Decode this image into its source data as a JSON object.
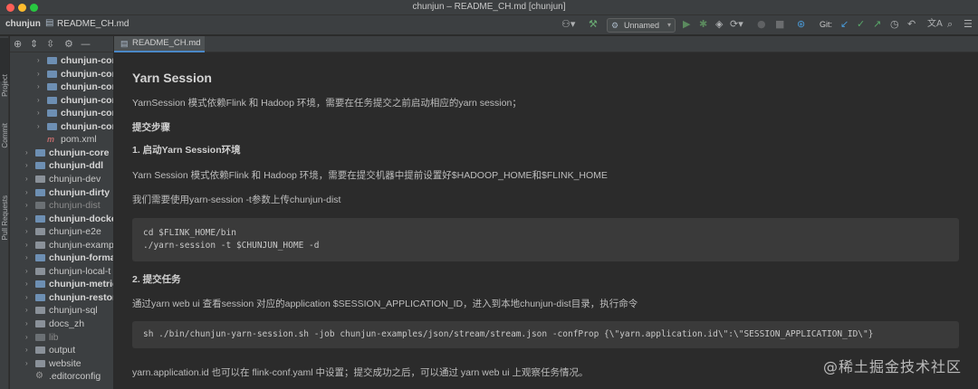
{
  "window": {
    "title": "chunjun – README_CH.md [chunjun]",
    "traffic_colors": [
      "#ff5f57",
      "#febc2e",
      "#28c840"
    ]
  },
  "navbar": {
    "project": "chunjun",
    "file": "README_CH.md",
    "run_config": "Unnamed",
    "git_label": "Git:"
  },
  "stripe": {
    "project": "Project",
    "commit": "Commit",
    "pull_requests": "Pull Requests"
  },
  "tree": [
    {
      "label": "chunjun-con",
      "kind": "module",
      "bold": true,
      "indent": 1
    },
    {
      "label": "chunjun-con",
      "kind": "module",
      "bold": true,
      "indent": 1
    },
    {
      "label": "chunjun-con",
      "kind": "module",
      "bold": true,
      "indent": 1
    },
    {
      "label": "chunjun-con",
      "kind": "module",
      "bold": true,
      "indent": 1
    },
    {
      "label": "chunjun-con",
      "kind": "module",
      "bold": true,
      "indent": 1
    },
    {
      "label": "chunjun-con",
      "kind": "module",
      "bold": true,
      "indent": 1
    },
    {
      "label": "pom.xml",
      "kind": "pom",
      "bold": false,
      "indent": 1
    },
    {
      "label": "chunjun-core",
      "kind": "module",
      "bold": true,
      "indent": 0
    },
    {
      "label": "chunjun-ddl",
      "kind": "module",
      "bold": true,
      "indent": 0
    },
    {
      "label": "chunjun-dev",
      "kind": "folder",
      "bold": false,
      "indent": 0
    },
    {
      "label": "chunjun-dirty",
      "kind": "module",
      "bold": true,
      "indent": 0
    },
    {
      "label": "chunjun-dist",
      "kind": "grey",
      "bold": false,
      "indent": 0
    },
    {
      "label": "chunjun-docke",
      "kind": "module",
      "bold": true,
      "indent": 0
    },
    {
      "label": "chunjun-e2e",
      "kind": "folder",
      "bold": false,
      "indent": 0
    },
    {
      "label": "chunjun-examp",
      "kind": "folder",
      "bold": false,
      "indent": 0
    },
    {
      "label": "chunjun-forma",
      "kind": "module",
      "bold": true,
      "indent": 0
    },
    {
      "label": "chunjun-local-t",
      "kind": "folder",
      "bold": false,
      "indent": 0
    },
    {
      "label": "chunjun-metric",
      "kind": "module",
      "bold": true,
      "indent": 0
    },
    {
      "label": "chunjun-restor",
      "kind": "module",
      "bold": true,
      "indent": 0
    },
    {
      "label": "chunjun-sql",
      "kind": "folder",
      "bold": false,
      "indent": 0
    },
    {
      "label": "docs_zh",
      "kind": "folder",
      "bold": false,
      "indent": 0
    },
    {
      "label": "lib",
      "kind": "grey",
      "bold": false,
      "indent": 0
    },
    {
      "label": "output",
      "kind": "folder",
      "bold": false,
      "indent": 0
    },
    {
      "label": "website",
      "kind": "folder",
      "bold": false,
      "indent": 0
    },
    {
      "label": ".editorconfig",
      "kind": "config",
      "bold": false,
      "indent": 0
    }
  ],
  "editor": {
    "tab_label": "README_CH.md",
    "heading": "Yarn Session",
    "intro": "YarnSession 模式依赖Flink 和 Hadoop 环境，需要在任务提交之前启动相应的yarn session；",
    "steps_title": "提交步骤",
    "step1_title": "1. 启动Yarn Session环境",
    "step1_text": "Yarn Session 模式依赖Flink 和 Hadoop 环境，需要在提交机器中提前设置好$HADOOP_HOME和$FLINK_HOME",
    "step1_text2": "我们需要使用yarn-session -t参数上传chunjun-dist",
    "code1_line1": "cd $FLINK_HOME/bin",
    "code1_line2": "./yarn-session -t $CHUNJUN_HOME -d",
    "step2_title": "2. 提交任务",
    "step2_text": "通过yarn web ui 查看session 对应的application $SESSION_APPLICATION_ID，进入到本地chunjun-dist目录，执行命令",
    "code2_line1": "sh ./bin/chunjun-yarn-session.sh -job chunjun-examples/json/stream/stream.json -confProp {\\\"yarn.application.id\\\":\\\"SESSION_APPLICATION_ID\\\"}",
    "step2_text2": "yarn.application.id 也可以在 flink-conf.yaml 中设置；提交成功之后，可以通过 yarn web ui 上观察任务情况。"
  },
  "watermark": "@稀土掘金技术社区"
}
